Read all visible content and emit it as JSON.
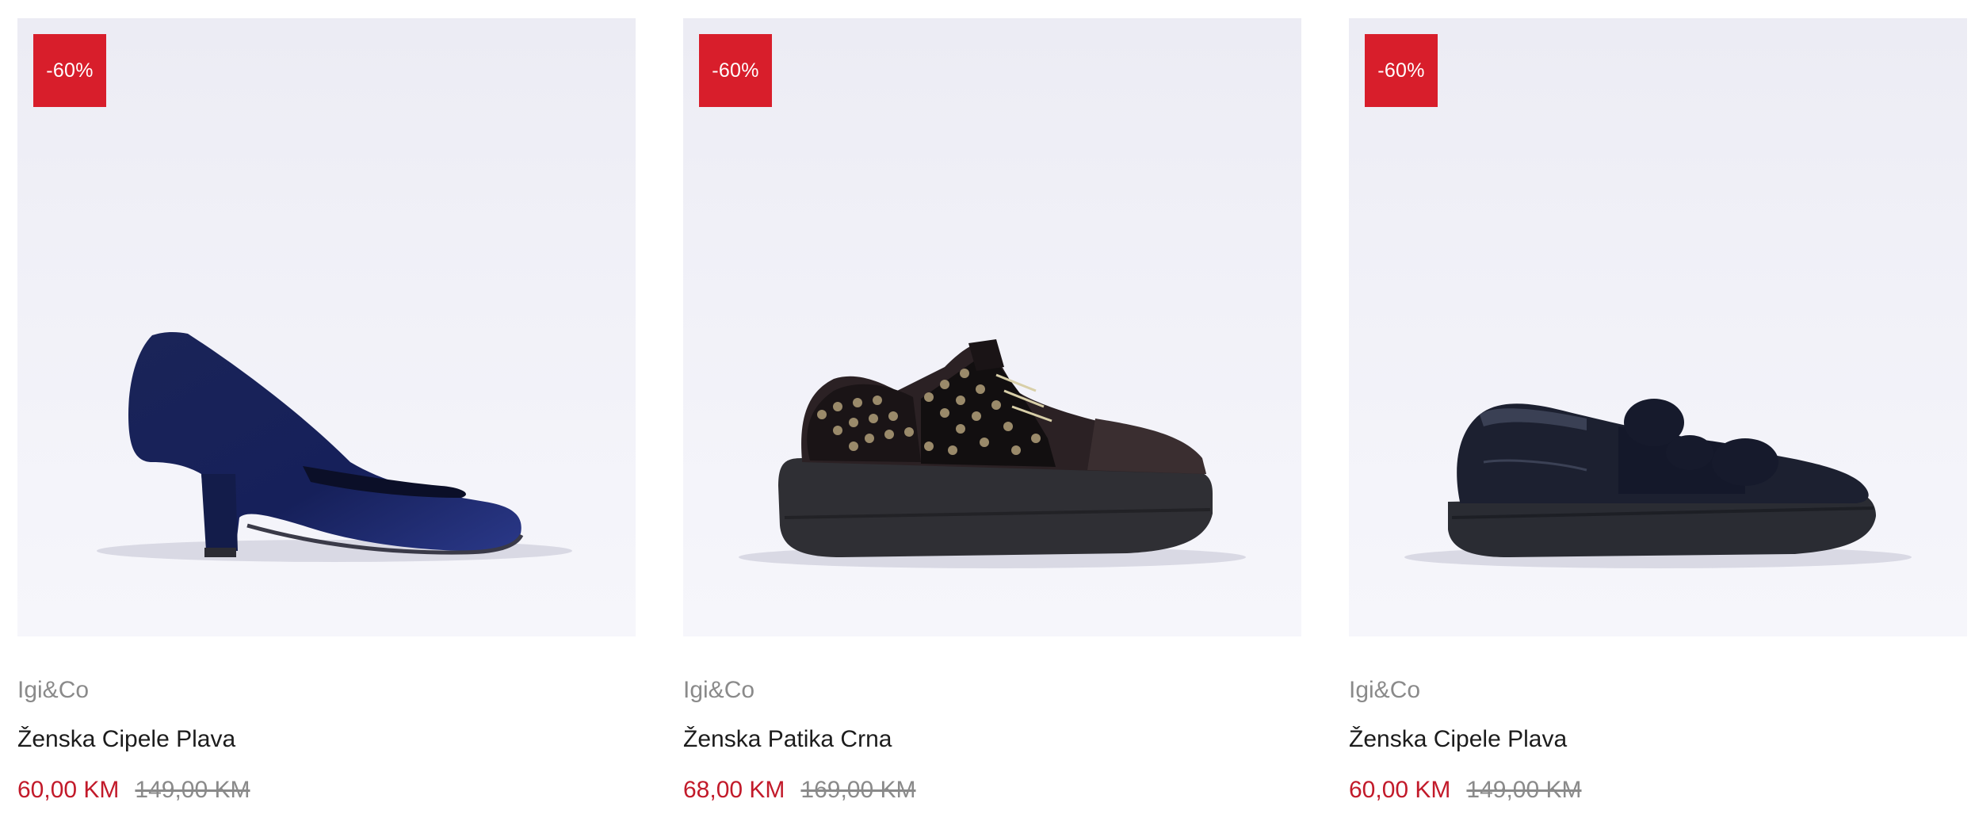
{
  "colors": {
    "badge_bg": "#d81e2b",
    "sale_price": "#c21a2a",
    "old_price": "#8a8a8a",
    "image_bg": "#efeff6"
  },
  "products": [
    {
      "badge": "-60%",
      "image_icon": "blue-velvet-pump-shoe",
      "brand": "Igi&Co",
      "name": "Ženska Cipele Plava",
      "price": "60,00 KM",
      "old_price": "149,00 KM"
    },
    {
      "badge": "-60%",
      "image_icon": "black-studded-sneaker-shoe",
      "brand": "Igi&Co",
      "name": "Ženska Patika Crna",
      "price": "68,00 KM",
      "old_price": "169,00 KM"
    },
    {
      "badge": "-60%",
      "image_icon": "navy-fur-loafer-shoe",
      "brand": "Igi&Co",
      "name": "Ženska Cipele Plava",
      "price": "60,00 KM",
      "old_price": "149,00 KM"
    }
  ]
}
